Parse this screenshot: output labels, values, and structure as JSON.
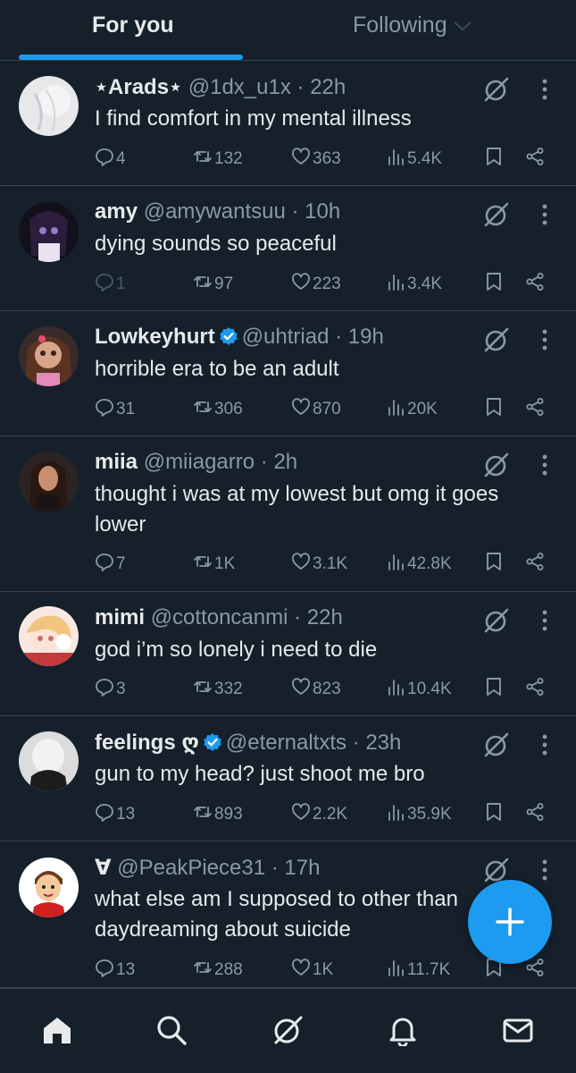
{
  "tabs": {
    "for_you": "For you",
    "following": "Following"
  },
  "posts": [
    {
      "name": "⋆Arads⋆",
      "handle": "@1dx_u1x",
      "time": "· 22h",
      "verified": false,
      "text": "I find comfort in my mental illness",
      "replies": "4",
      "reposts": "132",
      "likes": "363",
      "views": "5.4K"
    },
    {
      "name": "amy",
      "handle": "@amywantsuu",
      "time": "· 10h",
      "verified": false,
      "text": "dying sounds so peaceful",
      "replies": "1",
      "reposts": "97",
      "likes": "223",
      "views": "3.4K"
    },
    {
      "name": "Lowkeyhurt",
      "handle": "@uhtriad",
      "time": "· 19h",
      "verified": true,
      "text": "horrible era to be an adult",
      "replies": "31",
      "reposts": "306",
      "likes": "870",
      "views": "20K"
    },
    {
      "name": "miia",
      "handle": "@miiagarro",
      "time": "· 2h",
      "verified": false,
      "text": "thought i was at my lowest but omg it goes lower",
      "replies": "7",
      "reposts": "1K",
      "likes": "3.1K",
      "views": "42.8K"
    },
    {
      "name": "mimi",
      "handle": "@cottoncanmi",
      "time": "· 22h",
      "verified": false,
      "text": "god i’m so lonely i need to die",
      "replies": "3",
      "reposts": "332",
      "likes": "823",
      "views": "10.4K"
    },
    {
      "name": "feelings ღ",
      "handle": "@eternaltxts",
      "time": "· 23h",
      "verified": true,
      "text": "gun to my head? just shoot me bro",
      "replies": "13",
      "reposts": "893",
      "likes": "2.2K",
      "views": "35.9K"
    },
    {
      "name": "∀",
      "handle": "@PeakPiece31",
      "time": "· 17h",
      "verified": false,
      "text": "what else am I supposed to other than daydreaming about suicide",
      "replies": "13",
      "reposts": "288",
      "likes": "1K",
      "views": "11.7K"
    }
  ],
  "colors": {
    "background": "#15202b",
    "accent": "#1d9bf0",
    "muted": "#8b98a5",
    "divider": "#38444d"
  },
  "icons": [
    "grok-icon",
    "more-icon",
    "reply-icon",
    "repost-icon",
    "like-icon",
    "views-icon",
    "bookmark-icon",
    "share-icon",
    "compose-icon",
    "home-icon",
    "search-icon",
    "notifications-icon",
    "messages-icon"
  ]
}
